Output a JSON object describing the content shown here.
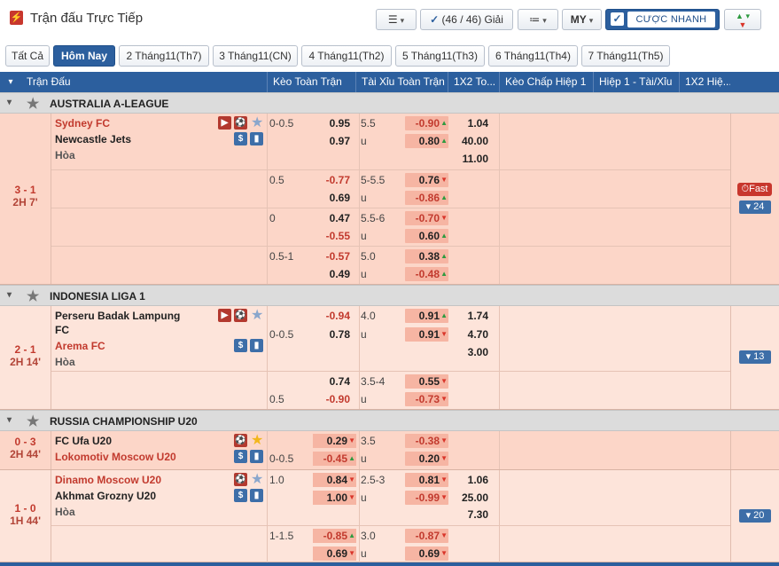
{
  "header": {
    "title": "Trận đấu Trực Tiếp",
    "filter_count": "(46 / 46) Giải",
    "odds_type": "MY",
    "quick_bet": "CƯỢC NHANH"
  },
  "tabs": [
    "Tất Cả",
    "Hôm Nay",
    "2 Tháng11(Th7)",
    "3 Tháng11(CN)",
    "4 Tháng11(Th2)",
    "5 Tháng11(Th3)",
    "6 Tháng11(Th4)",
    "7 Tháng11(Th5)"
  ],
  "columns": [
    "Trận Đấu",
    "Kèo Toàn Trận",
    "Tài Xỉu Toàn Trận",
    "1X2 To...",
    "Kèo Chấp Hiệp 1",
    "Hiệp 1 - Tài/Xỉu",
    "1X2 Hiệ..."
  ],
  "leagues": [
    {
      "name": "AUSTRALIA A-LEAGUE"
    },
    {
      "name": "INDONESIA LIGA 1"
    },
    {
      "name": "RUSSIA CHAMPIONSHIP U20"
    }
  ],
  "draw_label": "Hòa",
  "under_label": "u",
  "m1": {
    "score": "3 - 1",
    "clock": "2H 7'",
    "home": "Sydney FC",
    "away": "Newcastle Jets",
    "fast": "Fast",
    "more": "24",
    "x12": [
      "1.04",
      "40.00",
      "11.00"
    ],
    "rows": [
      {
        "hcap": "0-0.5",
        "h1": "0.95",
        "h2": "0.97",
        "ou": "5.5",
        "o1": "-0.90",
        "o2": "0.80"
      },
      {
        "hcap": "0.5",
        "h1": "-0.77",
        "h2": "0.69",
        "ou": "5-5.5",
        "o1": "0.76",
        "o2": "-0.86"
      },
      {
        "hcap": "0",
        "h1": "0.47",
        "h2": "-0.55",
        "ou": "5.5-6",
        "o1": "-0.70",
        "o2": "0.60"
      },
      {
        "hcap": "0.5-1",
        "h1": "-0.57",
        "h2": "0.49",
        "ou": "5.0",
        "o1": "0.38",
        "o2": "-0.48"
      }
    ]
  },
  "m2": {
    "score": "2 - 1",
    "clock": "2H 14'",
    "home_line1": "Perseru Badak Lampung",
    "home_line2": "FC",
    "away": "Arema FC",
    "more": "13",
    "x12": [
      "1.74",
      "4.70",
      "3.00"
    ],
    "rows": [
      {
        "hcap": "0-0.5",
        "h1": "-0.94",
        "h2": "0.78",
        "ou": "4.0",
        "o1": "0.91",
        "o2": "0.91"
      },
      {
        "hcap": "0.5",
        "h1": "0.74",
        "h2": "-0.90",
        "ou": "3.5-4",
        "o1": "0.55",
        "o2": "-0.73"
      }
    ]
  },
  "m3": {
    "score": "0 - 3",
    "clock": "2H 44'",
    "home": "FC Ufa U20",
    "away": "Lokomotiv Moscow U20",
    "rows": [
      {
        "hcap": "0-0.5",
        "h1": "0.29",
        "h2": "-0.45",
        "ou": "3.5",
        "o1": "-0.38",
        "o2": "0.20"
      }
    ]
  },
  "m4": {
    "score": "1 - 0",
    "clock": "1H 44'",
    "home": "Dinamo Moscow U20",
    "away": "Akhmat Grozny U20",
    "more": "20",
    "x12": [
      "1.06",
      "25.00",
      "7.30"
    ],
    "rows": [
      {
        "hcap": "1.0",
        "h1": "0.84",
        "h2": "1.00",
        "ou": "2.5-3",
        "o1": "0.81",
        "o2": "-0.99"
      },
      {
        "hcap": "1-1.5",
        "h1": "-0.85",
        "h2": "0.69",
        "ou": "3.0",
        "o1": "-0.87",
        "o2": "0.69"
      }
    ]
  },
  "colors": {
    "header_blue": "#2c5f9e",
    "row_bg": "#fcd6c8",
    "odd_box": "#f6b5a3",
    "negative": "#c23a2e",
    "up": "#2d9a3f",
    "down": "#d9352a"
  }
}
